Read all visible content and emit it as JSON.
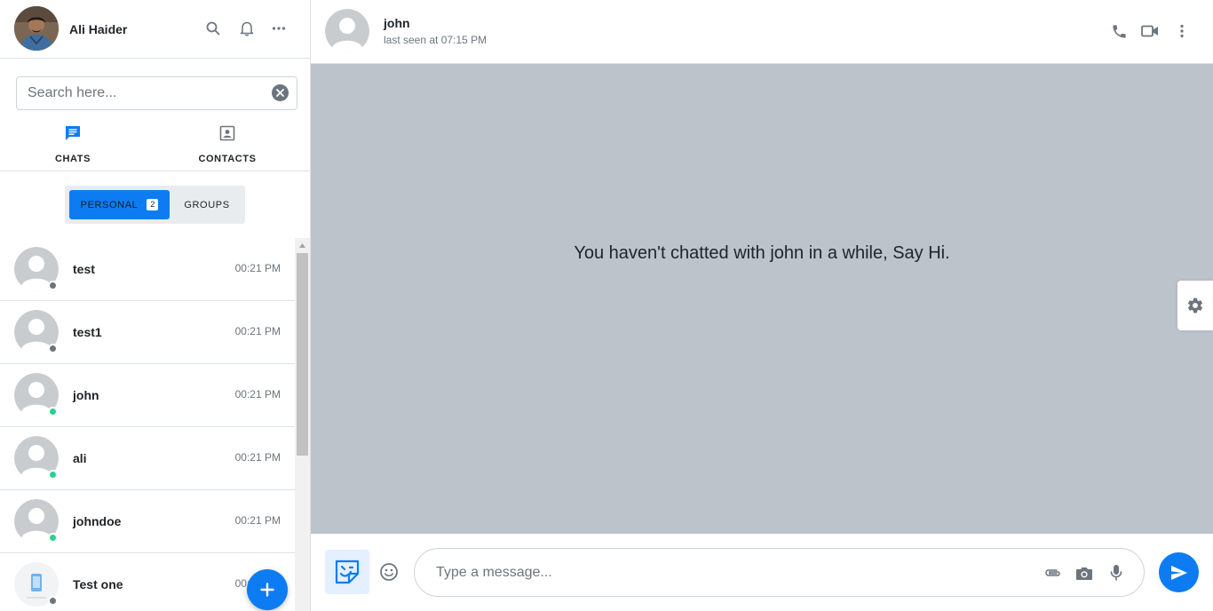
{
  "user": {
    "name": "Ali Haider",
    "avatar": "profile-photo"
  },
  "header_actions": [
    "search-icon",
    "bell-icon",
    "more-horizontal-icon"
  ],
  "search": {
    "placeholder": "Search here...",
    "value": ""
  },
  "tabs": [
    {
      "label": "CHATS",
      "icon": "chat-bubble-icon",
      "active": true
    },
    {
      "label": "CONTACTS",
      "icon": "contact-card-icon",
      "active": false
    }
  ],
  "segments": {
    "personal": {
      "label": "PERSONAL",
      "badge": "2"
    },
    "groups": {
      "label": "GROUPS"
    }
  },
  "chats": [
    {
      "name": "test",
      "time": "00:21 PM",
      "status": "offline"
    },
    {
      "name": "test1",
      "time": "00:21 PM",
      "status": "offline"
    },
    {
      "name": "john",
      "time": "00:21 PM",
      "status": "online"
    },
    {
      "name": "ali",
      "time": "00:21 PM",
      "status": "online"
    },
    {
      "name": "johndoe",
      "time": "00:21 PM",
      "status": "online"
    },
    {
      "name": "Test one",
      "time": "00:21 PM",
      "status": "offline",
      "avatar": "image"
    }
  ],
  "conversation": {
    "name": "john",
    "status": "last seen at 07:15 PM",
    "actions": [
      "phone-icon",
      "video-camera-icon",
      "more-vertical-icon"
    ],
    "empty_message": "You haven't chatted with john in a while, Say Hi."
  },
  "composer": {
    "placeholder": "Type a message...",
    "icons": [
      "sticker-icon",
      "emoji-icon",
      "paperclip-icon",
      "camera-icon",
      "microphone-icon",
      "send-icon"
    ]
  },
  "colors": {
    "accent": "#0d7cf2",
    "online": "#2bd18a",
    "offline": "#6c757d",
    "chat_background": "#bdc3cb"
  }
}
